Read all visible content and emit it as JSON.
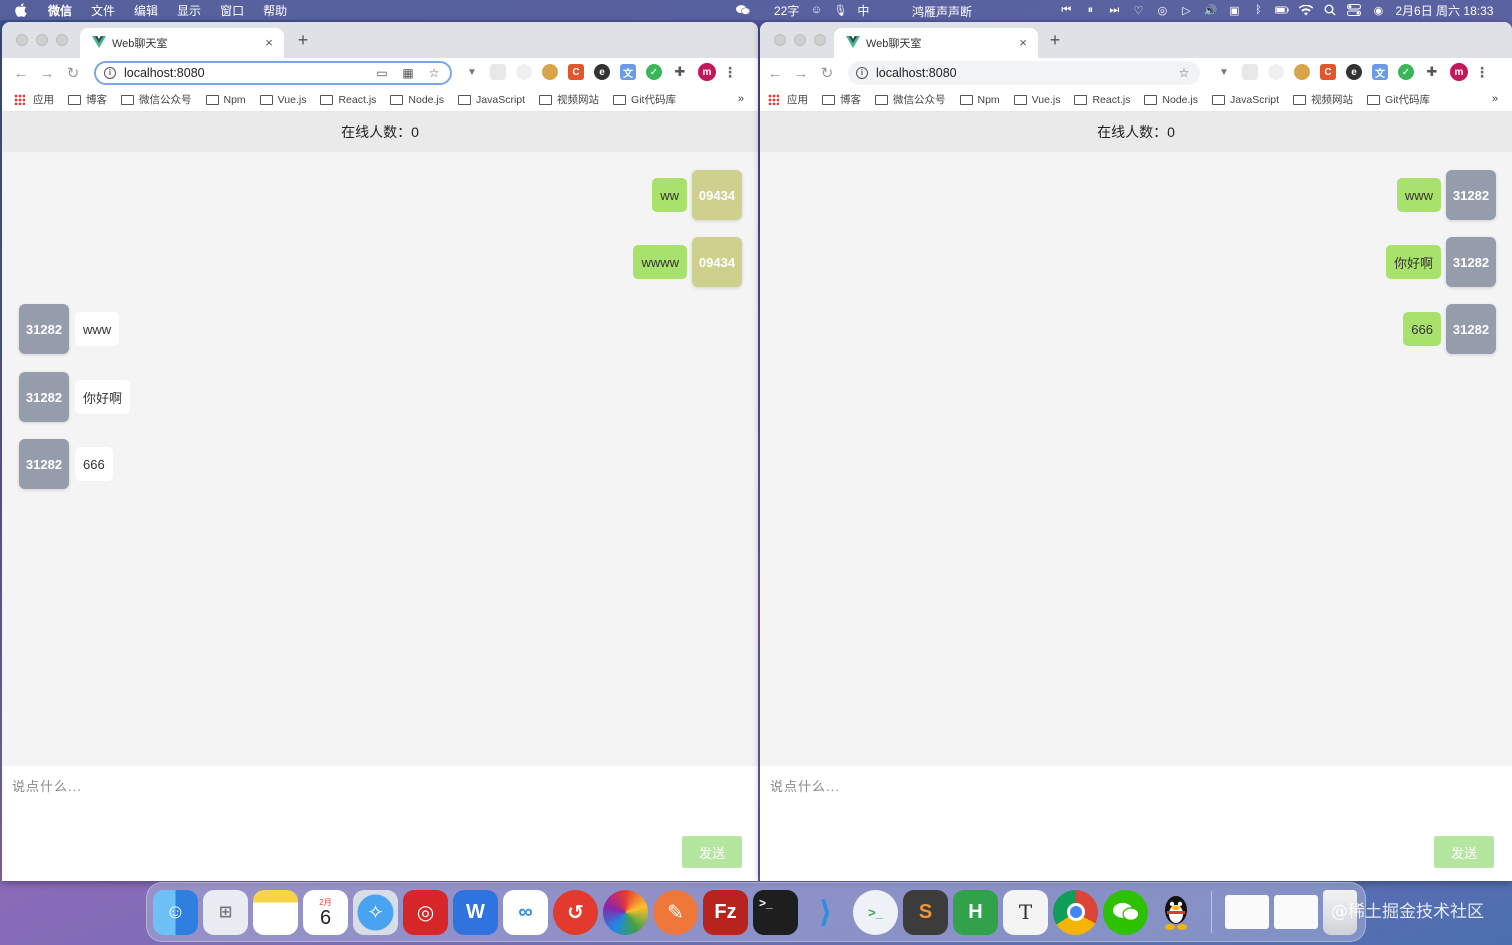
{
  "menubar": {
    "app_name": "微信",
    "menus": [
      "文件",
      "编辑",
      "显示",
      "窗口",
      "帮助"
    ],
    "song": "鸿雁声声断",
    "input_count": "22字",
    "ime": "中",
    "datetime": "2月6日 周六  18:33"
  },
  "windows": [
    {
      "tab_title": "Web聊天室",
      "url": "localhost:8080",
      "bookmarks": [
        "应用",
        "博客",
        "微信公众号",
        "Npm",
        "Vue.js",
        "React.js",
        "Node.js",
        "JavaScript",
        "视频网站",
        "Git代码库"
      ],
      "online_label": "在线人数：0",
      "messages": [
        {
          "side": "mine",
          "user": "09434",
          "text": "ww"
        },
        {
          "side": "mine",
          "user": "09434",
          "text": "wwww"
        },
        {
          "side": "theirs",
          "user": "31282",
          "text": "www"
        },
        {
          "side": "theirs",
          "user": "31282",
          "text": "你好啊"
        },
        {
          "side": "theirs",
          "user": "31282",
          "text": "666"
        }
      ],
      "input_placeholder": "说点什么...",
      "send_label": "发送"
    },
    {
      "tab_title": "Web聊天室",
      "url": "localhost:8080",
      "bookmarks": [
        "应用",
        "博客",
        "微信公众号",
        "Npm",
        "Vue.js",
        "React.js",
        "Node.js",
        "JavaScript",
        "视频网站",
        "Git代码库"
      ],
      "online_label": "在线人数：0",
      "messages": [
        {
          "side": "mine",
          "user": "31282",
          "text": "www"
        },
        {
          "side": "mine",
          "user": "31282",
          "text": "你好啊"
        },
        {
          "side": "mine",
          "user": "31282",
          "text": "666"
        }
      ],
      "input_placeholder": "说点什么...",
      "send_label": "发送"
    }
  ],
  "bookmarks_more": "»",
  "dock": {
    "calendar_month": "2月",
    "calendar_day": "6",
    "items": [
      "finder-icon",
      "launchpad-icon",
      "notes-icon",
      "calendar-icon",
      "safari-icon",
      "netease-music-icon",
      "wps-icon",
      "baidu-netdisk-icon",
      "lite-app-icon",
      "colorful-app-icon",
      "paw-icon",
      "filezilla-icon",
      "terminal-icon",
      "vscode-icon",
      "iterm-chat-icon",
      "sublime-icon",
      "hbuilder-icon",
      "typora-icon",
      "chrome-icon",
      "wechat-icon",
      "qq-icon",
      "window-thumb-icon",
      "window-thumb-icon",
      "trash-icon"
    ]
  },
  "watermark": "@稀土掘金技术社区"
}
